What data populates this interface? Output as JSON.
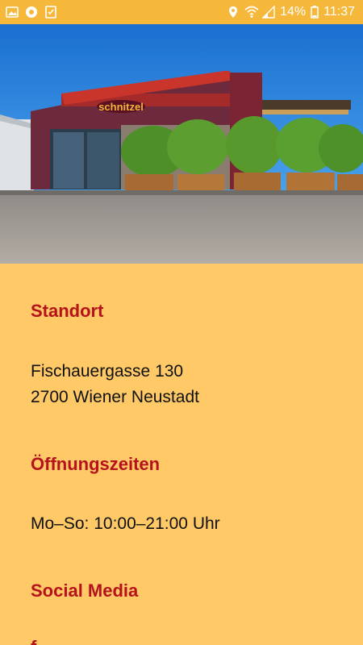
{
  "statusbar": {
    "battery_percent": "14%",
    "time": "11:37",
    "left_icons": [
      "gallery-icon",
      "chrome-icon",
      "clipboard-check-icon"
    ],
    "right_icons": [
      "location-icon",
      "wifi-icon",
      "signal-icon",
      "battery-icon"
    ]
  },
  "hero": {
    "sign_text": "schnitzel"
  },
  "location": {
    "title": "Standort",
    "address_line1": "Fischauergasse 130",
    "address_line2": "2700 Wiener Neustadt"
  },
  "hours": {
    "title": "Öffnungszeiten",
    "text": "Mo–So: 10:00–21:00 Uhr"
  },
  "social": {
    "title": "Social Media",
    "facebook_glyph": "f"
  },
  "colors": {
    "background": "#fec966",
    "statusbar": "#f5b83a",
    "accent": "#b5121b"
  }
}
